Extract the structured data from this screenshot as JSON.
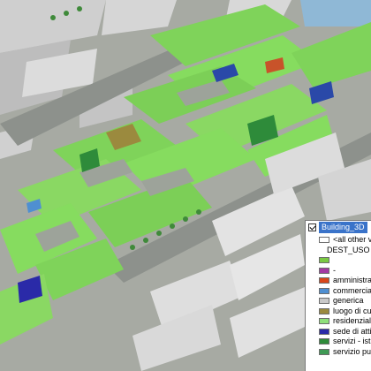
{
  "legend": {
    "layer_name": "Building_3D",
    "layer_visible": true,
    "other_values_label": "<all other va",
    "field_name": "DEST_USO",
    "classes": [
      {
        "label": "",
        "color": "#7ac943"
      },
      {
        "label": "-",
        "color": "#a33aa3"
      },
      {
        "label": "amministrat",
        "color": "#d9461a"
      },
      {
        "label": "commerciale",
        "color": "#4f8fd1"
      },
      {
        "label": "generica",
        "color": "#c9c9c9"
      },
      {
        "label": "luogo di cult",
        "color": "#9b8a3e"
      },
      {
        "label": "residenziale",
        "color": "#8fe07a"
      },
      {
        "label": "sede di attivi",
        "color": "#2a2aa8"
      },
      {
        "label": "servizi - istru",
        "color": "#2e8b3a"
      },
      {
        "label": "servizio pub",
        "color": "#3f9a55"
      }
    ]
  }
}
